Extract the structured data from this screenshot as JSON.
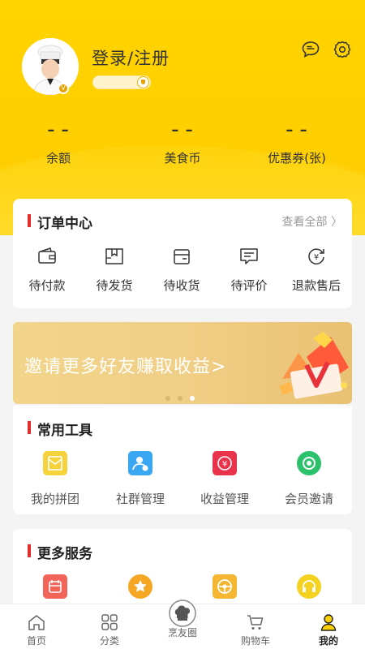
{
  "header": {
    "login_text": "登录/注册",
    "stats": [
      {
        "value": "– –",
        "label": "余额"
      },
      {
        "value": "– –",
        "label": "美食币"
      },
      {
        "value": "– –",
        "label": "优惠券(张)"
      }
    ],
    "avatar_badge": "V",
    "icons": [
      "message-icon",
      "settings-icon"
    ]
  },
  "orders": {
    "title": "订单中心",
    "see_all": "查看全部 〉",
    "items": [
      {
        "label": "待付款",
        "icon": "wallet-icon"
      },
      {
        "label": "待发货",
        "icon": "package-icon"
      },
      {
        "label": "待收货",
        "icon": "receive-box-icon"
      },
      {
        "label": "待评价",
        "icon": "comment-icon"
      },
      {
        "label": "退款售后",
        "icon": "refund-icon"
      }
    ]
  },
  "banner": {
    "text": "邀请更多好友赚取收益>",
    "dots": 3,
    "active_dot": 2
  },
  "tools": {
    "title": "常用工具",
    "items": [
      {
        "label": "我的拼团",
        "color": "#f6d23c",
        "icon": "group-buy-icon"
      },
      {
        "label": "社群管理",
        "color": "#3aa7f2",
        "icon": "community-icon"
      },
      {
        "label": "收益管理",
        "color": "#e8334a",
        "icon": "earnings-icon"
      },
      {
        "label": "会员邀请",
        "color": "#2cc26b",
        "icon": "invite-icon"
      }
    ]
  },
  "services": {
    "title": "更多服务",
    "items": [
      {
        "color": "#f26457",
        "icon": "calendar-icon"
      },
      {
        "color": "#f5a623",
        "icon": "star-icon"
      },
      {
        "color": "#f5b731",
        "icon": "steering-icon"
      },
      {
        "color": "#f4d21f",
        "icon": "headset-icon"
      }
    ]
  },
  "tabbar": {
    "items": [
      {
        "label": "首页",
        "icon": "home-icon"
      },
      {
        "label": "分类",
        "icon": "category-icon"
      },
      {
        "label": "烹友圈",
        "icon": "chef-hat-icon"
      },
      {
        "label": "购物车",
        "icon": "cart-icon"
      },
      {
        "label": "我的",
        "icon": "profile-icon",
        "active": true
      }
    ]
  }
}
